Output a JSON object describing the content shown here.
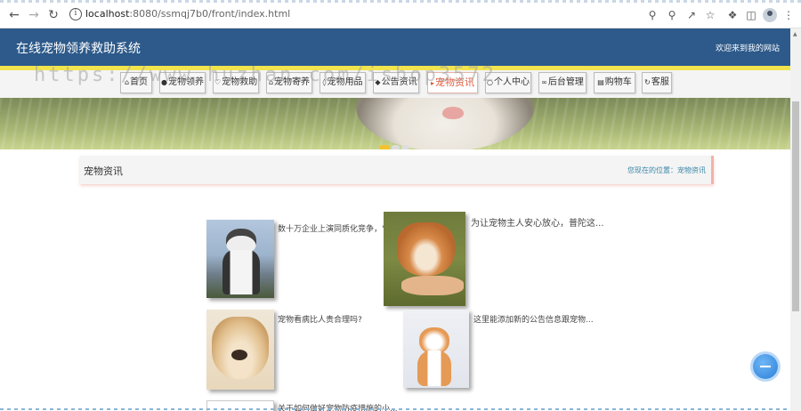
{
  "browser": {
    "url_host": "localhost",
    "url_path": ":8080/ssmqj7b0/front/index.html",
    "back_icon": "arrow-left-icon",
    "forward_icon": "arrow-right-icon",
    "reload_icon": "reload-icon",
    "tools": [
      "key-icon",
      "zoom-icon",
      "share-icon",
      "star-icon",
      "extension-icon",
      "sidepanel-icon",
      "profile-icon",
      "menu-icon"
    ]
  },
  "header": {
    "title": "在线宠物领养救助系统",
    "welcome": "欢迎来到我的网站",
    "bg_color": "#2d5a8a",
    "accent_color": "#f1e44d"
  },
  "watermark": "https://www.huzhan.com/ishop3572",
  "nav": {
    "items": [
      {
        "label": "首页",
        "icon": "home-icon"
      },
      {
        "label": "宠物领养",
        "icon": "paw-icon"
      },
      {
        "label": "宠物救助",
        "icon": "heart-icon"
      },
      {
        "label": "宠物寄养",
        "icon": "house-icon"
      },
      {
        "label": "宠物用品",
        "icon": "bag-icon"
      },
      {
        "label": "公告资讯",
        "icon": "bell-icon"
      },
      {
        "label": "宠物资讯",
        "icon": "news-icon",
        "active": true
      },
      {
        "label": "个人中心",
        "icon": "user-icon"
      },
      {
        "label": "后台管理",
        "icon": "link-icon"
      },
      {
        "label": "购物车",
        "icon": "cart-icon"
      },
      {
        "label": "客服",
        "icon": "chat-icon"
      }
    ]
  },
  "banner": {
    "slide_count": 3,
    "active_slide": 1
  },
  "section": {
    "title": "宠物资讯",
    "breadcrumb": "您现在的位置：宠物资讯"
  },
  "news": [
    {
      "text": "数十万企业上演同质化竞争，\"宠",
      "image": "husky"
    },
    {
      "text": "为让宠物主人安心放心，普陀这...",
      "image": "akita"
    },
    {
      "text": "宠物看病比人贵合理吗?",
      "image": "labrador"
    },
    {
      "text": "这里能添加新的公告信息跟宠物...",
      "image": "kitten"
    },
    {
      "text": "关于如何做好宠物防疫措施的小...",
      "image": "broken"
    }
  ]
}
